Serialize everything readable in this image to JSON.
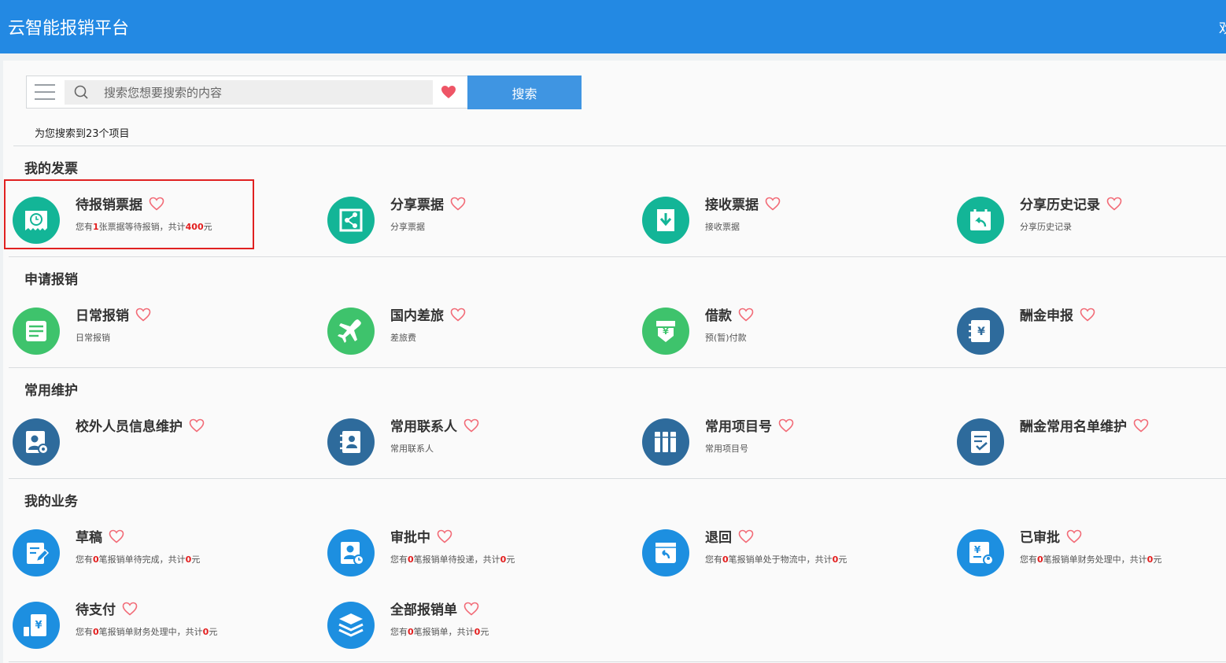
{
  "app": {
    "title": "云智能报销平台",
    "welcome": "欢"
  },
  "search": {
    "placeholder": "搜索您想要搜索的内容",
    "button": "搜索",
    "result_text": "为您搜索到23个项目"
  },
  "colors": {
    "topbar": "#2389e3",
    "green": "#1ab394",
    "lightgreen": "#3ec36c",
    "steel": "#2f6ea0",
    "blue": "#1f8fe0",
    "heart": "#f26b77",
    "highlight": "#e31d1d"
  },
  "sections": [
    {
      "title": "我的发票",
      "items": [
        {
          "name": "待报销票据",
          "icon": "alarm-clock-ticket-icon",
          "desc_parts": [
            "您有",
            "1",
            "张票据等待报销，共计",
            "400",
            "元"
          ]
        },
        {
          "name": "分享票据",
          "icon": "share-ticket-icon",
          "desc_parts": [
            "分享票据"
          ]
        },
        {
          "name": "接收票据",
          "icon": "receive-ticket-icon",
          "desc_parts": [
            "接收票据"
          ]
        },
        {
          "name": "分享历史记录",
          "icon": "share-history-icon",
          "desc_parts": [
            "分享历史记录"
          ]
        }
      ]
    },
    {
      "title": "申请报销",
      "items": [
        {
          "name": "日常报销",
          "icon": "document-list-icon",
          "desc_parts": [
            "日常报销"
          ]
        },
        {
          "name": "国内差旅",
          "icon": "airplane-icon",
          "desc_parts": [
            "差旅费"
          ]
        },
        {
          "name": "借款",
          "icon": "loan-money-icon",
          "desc_parts": [
            "预(暂)付款"
          ]
        },
        {
          "name": "酬金申报",
          "icon": "reward-declare-icon",
          "desc_parts": []
        }
      ]
    },
    {
      "title": "常用维护",
      "items": [
        {
          "name": "校外人员信息维护",
          "icon": "person-settings-icon",
          "desc_parts": []
        },
        {
          "name": "常用联系人",
          "icon": "contacts-book-icon",
          "desc_parts": [
            "常用联系人"
          ]
        },
        {
          "name": "常用项目号",
          "icon": "project-columns-icon",
          "desc_parts": [
            "常用项目号"
          ]
        },
        {
          "name": "酬金常用名单维护",
          "icon": "checklist-icon",
          "desc_parts": []
        }
      ]
    },
    {
      "title": "我的业务",
      "items": [
        {
          "name": "草稿",
          "icon": "draft-edit-icon",
          "desc_parts": [
            "您有",
            "0",
            "笔报销单待完成，共计",
            "0",
            "元"
          ]
        },
        {
          "name": "审批中",
          "icon": "approval-pending-icon",
          "desc_parts": [
            "您有",
            "0",
            "笔报销单待投递，共计",
            "0",
            "元"
          ]
        },
        {
          "name": "退回",
          "icon": "return-icon",
          "desc_parts": [
            "您有",
            "0",
            "笔报销单处于物流中，共计",
            "0",
            "元"
          ]
        },
        {
          "name": "已审批",
          "icon": "approved-icon",
          "desc_parts": [
            "您有",
            "0",
            "笔报销单财务处理中，共计",
            "0",
            "元"
          ]
        },
        {
          "name": "待支付",
          "icon": "pending-payment-icon",
          "desc_parts": [
            "您有",
            "0",
            "笔报销单财务处理中，共计",
            "0",
            "元"
          ]
        },
        {
          "name": "全部报销单",
          "icon": "all-forms-layers-icon",
          "desc_parts": [
            "您有",
            "0",
            "笔报销单，共计",
            "0",
            "元"
          ]
        }
      ]
    }
  ]
}
